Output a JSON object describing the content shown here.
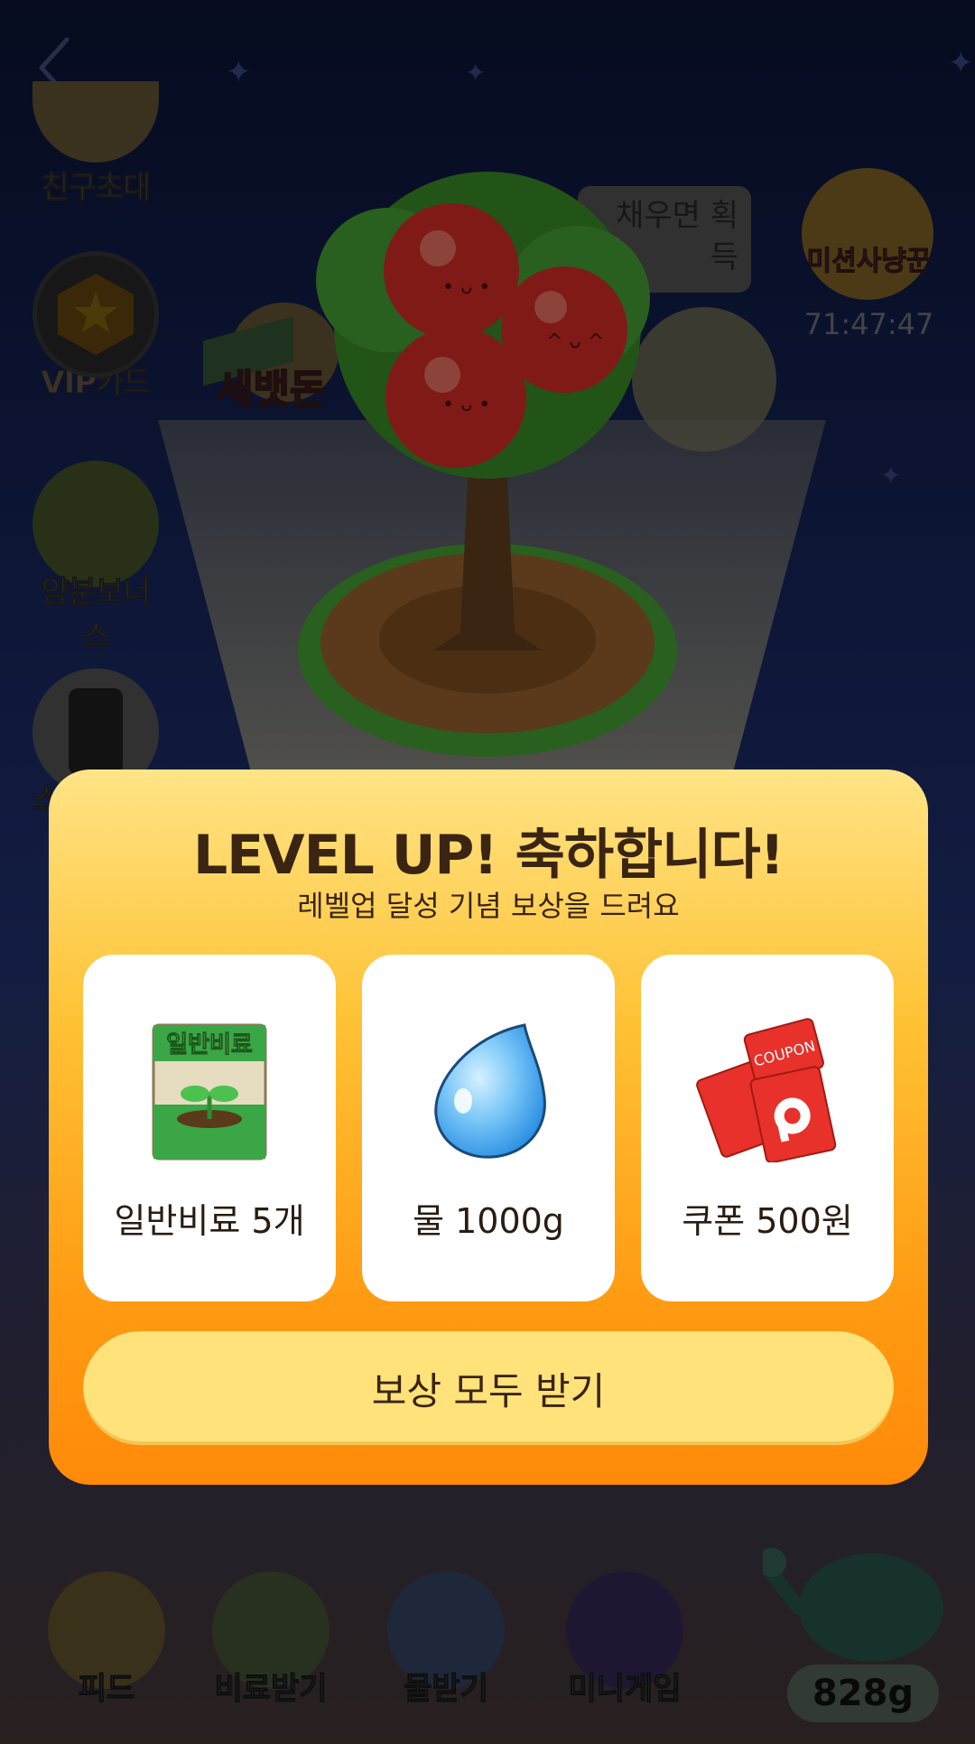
{
  "background": {
    "side_menu": [
      {
        "label": "친구초대"
      },
      {
        "label": "VIP카드"
      },
      {
        "label": "양분보너스"
      },
      {
        "label": "스"
      }
    ],
    "mission": {
      "label": "미션사냥꾼",
      "timer": "71:47:47"
    },
    "bubble_text": "채우면 획득",
    "sebat_label": "세뱃돈",
    "bottom_nav": [
      {
        "label": "피드"
      },
      {
        "label": "비료받기"
      },
      {
        "label": "물받기"
      },
      {
        "label": "미니게임"
      }
    ],
    "water_amount": "828g"
  },
  "modal": {
    "title": "LEVEL UP! 축하합니다!",
    "subtitle": "레벨업 달성 기념 보상을 드려요",
    "rewards": [
      {
        "label": "일반비료 5개",
        "icon": "fertilizer-bag-icon",
        "icon_text": "일반비료"
      },
      {
        "label": "물 1000g",
        "icon": "water-drop-icon"
      },
      {
        "label": "쿠폰 500원",
        "icon": "coupon-icon",
        "icon_text": "COUPON"
      }
    ],
    "claim_button": "보상 모두 받기"
  },
  "colors": {
    "modal_top": "#ffe486",
    "modal_bottom": "#ff8a0a",
    "button": "#ffe27a",
    "text_dark": "#3a2412"
  }
}
